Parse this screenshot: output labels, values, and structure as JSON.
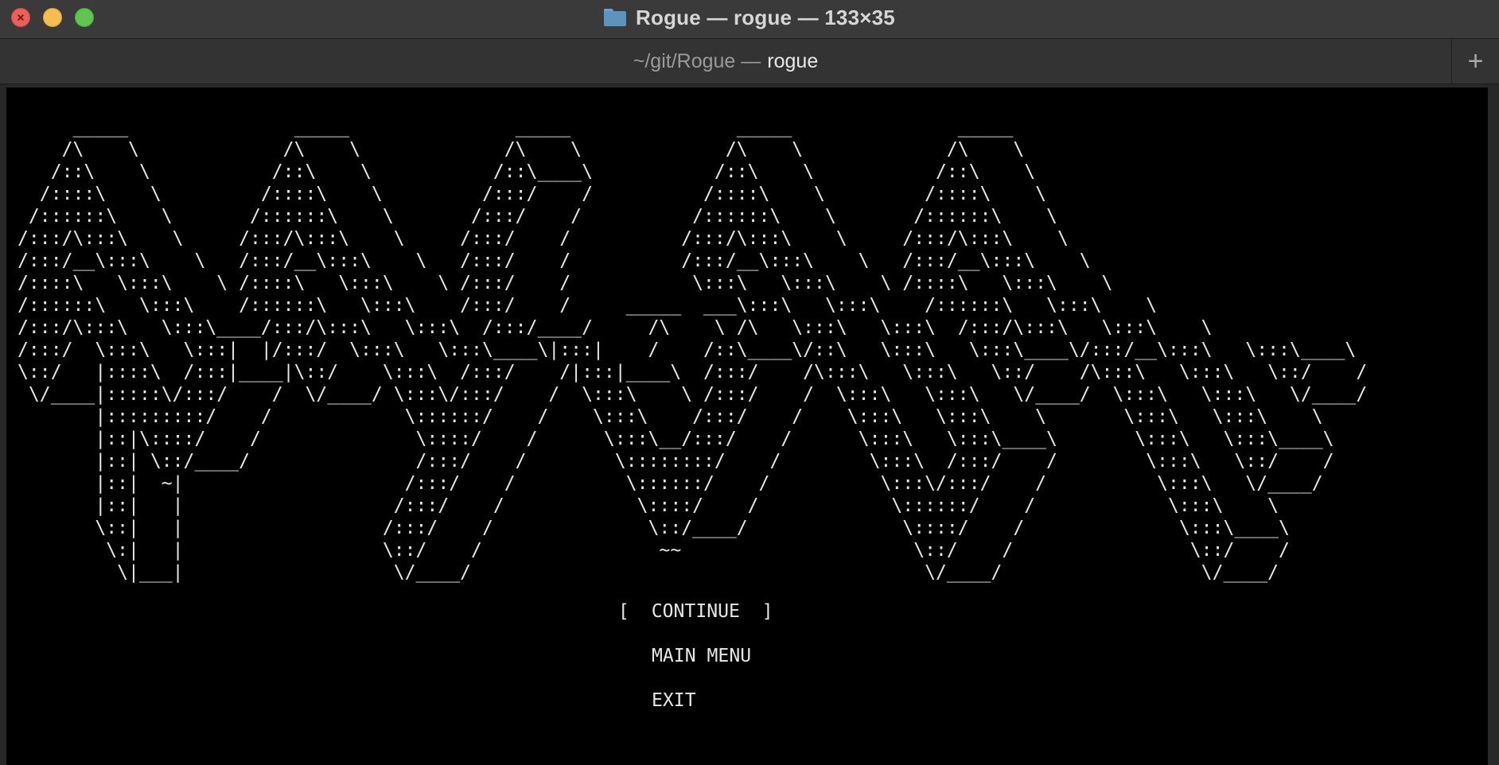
{
  "window": {
    "title": "Rogue — rogue — 133×35",
    "folder_icon": "folder-icon"
  },
  "tab": {
    "path": "~/git/Rogue —",
    "process": "rogue",
    "new_tab_label": "+"
  },
  "terminal": {
    "logo_ascii": "     _____               _____               _____               _____               _____\n    /\\    \\             /\\    \\             /\\    \\             /\\    \\             /\\    \\\n   /::\\    \\           /::\\    \\           /::\\____\\           /::\\    \\           /::\\    \\\n  /::::\\    \\         /::::\\    \\         /:::/    /          /::::\\    \\         /::::\\    \\\n /::::::\\    \\       /::::::\\    \\       /:::/    /          /::::::\\    \\       /::::::\\    \\\n/:::/\\:::\\    \\     /:::/\\:::\\    \\     /:::/    /          /:::/\\:::\\    \\     /:::/\\:::\\    \\\n/:::/__\\:::\\    \\   /:::/__\\:::\\    \\   /:::/    /          /:::/__\\:::\\    \\   /:::/__\\:::\\    \\\n/::::\\   \\:::\\    \\ /::::\\   \\:::\\    \\ /:::/    /           \\:::\\   \\:::\\    \\ /::::\\   \\:::\\    \\\n/::::::\\   \\:::\\    /::::::\\   \\:::\\    /:::/    /     _____  ___\\:::\\   \\:::\\    /::::::\\   \\:::\\    \\\n/:::/\\:::\\   \\:::\\____/:::/\\:::\\   \\:::\\  /:::/____/     /\\    \\ /\\   \\:::\\   \\:::\\  /:::/\\:::\\   \\:::\\    \\\n/:::/  \\:::\\   \\:::|  |/:::/  \\:::\\   \\:::\\____\\|:::|    /    /::\\____\\/::\\   \\:::\\   \\:::\\____\\/:::/__\\:::\\   \\:::\\____\\\n\\::/   |::::\\  /:::|____|\\::/    \\:::\\  /:::/    /|:::|____\\  /:::/    /\\:::\\   \\:::\\   \\::/    /\\:::\\   \\:::\\   \\::/    /\n \\/____|:::::\\/:::/    /  \\/____/ \\:::\\/:::/    /  \\:::\\    \\ /:::/    /  \\:::\\   \\:::\\   \\/____/  \\:::\\   \\:::\\   \\/____/\n       |:::::::::/    /            \\::::::/    /    \\:::\\    /:::/    /    \\:::\\   \\:::\\    \\       \\:::\\   \\:::\\    \\\n       |::|\\::::/    /              \\::::/    /      \\:::\\__/:::/    /      \\:::\\   \\:::\\____\\       \\:::\\   \\:::\\____\\\n       |::| \\::/____/               /:::/    /        \\::::::::/    /        \\:::\\  /:::/    /        \\:::\\   \\::/    /\n       |::|  ~|                    /:::/    /          \\::::::/    /          \\:::\\/:::/    /          \\:::\\   \\/____/\n       |::|   |                   /:::/    /            \\::::/    /            \\::::::/    /            \\:::\\    \\\n       \\::|   |                  /:::/    /              \\::/____/              \\::::/    /              \\:::\\____\\\n        \\:|   |                  \\::/    /                ~~                     \\::/    /                \\::/    /\n         \\|___|                   \\/____/                                         \\/____/                  \\/____/",
    "menu": {
      "continue_open": "[",
      "continue_label": "CONTINUE",
      "continue_close": "]",
      "main_menu_label": "MAIN MENU",
      "exit_label": "EXIT"
    }
  },
  "colors": {
    "titlebar": "#3a3a3a",
    "tabbar": "#333333",
    "terminal_bg": "#000000",
    "terminal_fg": "#e6e6e6",
    "close": "#ec5f5a",
    "minimize": "#f5be4f",
    "maximize": "#5ec64e"
  }
}
